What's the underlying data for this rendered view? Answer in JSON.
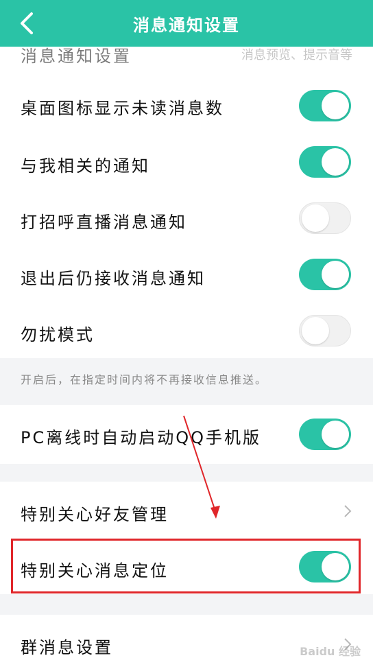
{
  "header": {
    "title": "消息通知设置"
  },
  "partial_row": {
    "label": "消息通知设置",
    "value": "消息预览、提示音等"
  },
  "settings": [
    {
      "label": "桌面图标显示未读消息数",
      "on": true
    },
    {
      "label": "与我相关的通知",
      "on": true
    },
    {
      "label": "打招呼直播消息通知",
      "on": false
    },
    {
      "label": "退出后仍接收消息通知",
      "on": true
    },
    {
      "label": "勿扰模式",
      "on": false
    }
  ],
  "note": "开启后，在指定时间内将不再接收信息推送。",
  "pc_row": {
    "label": "PC离线时自动启动QQ手机版",
    "on": true
  },
  "special_manage": {
    "label": "特别关心好友管理"
  },
  "special_locate": {
    "label": "特别关心消息定位",
    "on": true
  },
  "group_settings": {
    "label": "群消息设置"
  },
  "watermark": "Baidu 经验",
  "colors": {
    "accent": "#2ac3a6",
    "highlight": "#e0262a"
  }
}
